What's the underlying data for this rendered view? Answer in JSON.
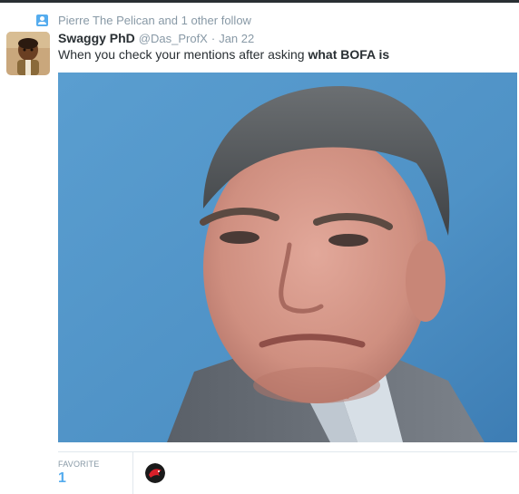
{
  "social_context": {
    "text": "Pierre The Pelican and 1 other follow",
    "icon": "follow-icon"
  },
  "tweet": {
    "fullname": "Swaggy PhD",
    "username": "@Das_ProfX",
    "separator": "·",
    "timestamp": "Jan 22",
    "text_plain": "When you check your mentions after asking ",
    "text_bold": "what BOFA is"
  },
  "stats": {
    "favorite_label": "FAVORITE",
    "favorite_count": "1"
  },
  "colors": {
    "accent": "#55acee",
    "muted": "#8899a6",
    "text": "#292f33",
    "border": "#e1e8ed"
  }
}
